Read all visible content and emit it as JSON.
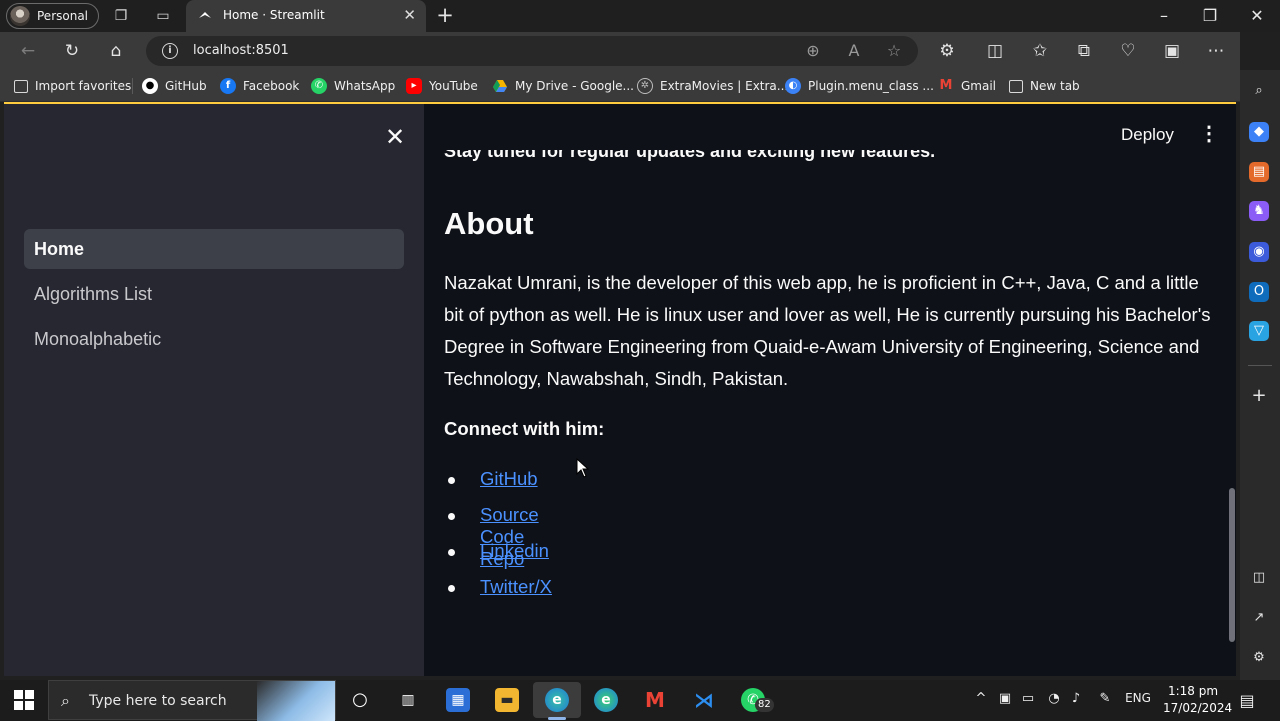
{
  "browser": {
    "profile_label": "Personal",
    "tab_title": "Home · Streamlit",
    "url": "localhost:8501",
    "favorites": [
      {
        "label": "Import favorites",
        "icon": "import-icon",
        "color": "#d9d9d9"
      },
      {
        "label": "GitHub",
        "icon": "github-icon",
        "color": "#ffffff"
      },
      {
        "label": "Facebook",
        "icon": "facebook-icon",
        "color": "#1877f2"
      },
      {
        "label": "WhatsApp",
        "icon": "whatsapp-icon",
        "color": "#25d366"
      },
      {
        "label": "YouTube",
        "icon": "youtube-icon",
        "color": "#ff0000"
      },
      {
        "label": "My Drive - Google...",
        "icon": "google-drive-icon",
        "color": "#f4b400"
      },
      {
        "label": "ExtraMovies | Extra...",
        "icon": "extramovies-icon",
        "color": "#bdbdbd"
      },
      {
        "label": "Plugin.menu_class ...",
        "icon": "plugin-icon",
        "color": "#3b82f6"
      },
      {
        "label": "Gmail",
        "icon": "gmail-icon",
        "color": "#ea4335"
      },
      {
        "label": "New tab",
        "icon": "new-tab-icon",
        "color": "#d9d9d9"
      }
    ]
  },
  "app": {
    "deploy_label": "Deploy",
    "sidebar_items": [
      {
        "label": "Home",
        "active": true
      },
      {
        "label": "Algorithms List",
        "active": false
      },
      {
        "label": "Monoalphabetic",
        "active": false
      }
    ],
    "cut_text": "Stay tuned for regular updates and exciting new features.",
    "about_heading": "About",
    "about_paragraph": "Nazakat Umrani, is the developer of this web app, he is proficient in C++, Java, C and a little bit of python as well. He is linux user and lover as well, He is currently pursuing his Bachelor's Degree in Software Engineering from Quaid-e-Awam University of Engineering, Science and Technology, Nawabshah, Sindh, Pakistan.",
    "connect_heading": "Connect with him:",
    "links": [
      "GitHub",
      "Source Code Repo",
      "Linkedin",
      "Twitter/X"
    ]
  },
  "taskbar": {
    "search_placeholder": "Type here to search",
    "whatsapp_badge": "82",
    "language": "ENG",
    "time": "1:18 pm",
    "date": "17/02/2024"
  },
  "colors": {
    "streamlit_bg": "#0e1117",
    "streamlit_sidebar": "#262730",
    "link": "#4b91ff",
    "accent_bar": "#ffcc40"
  }
}
